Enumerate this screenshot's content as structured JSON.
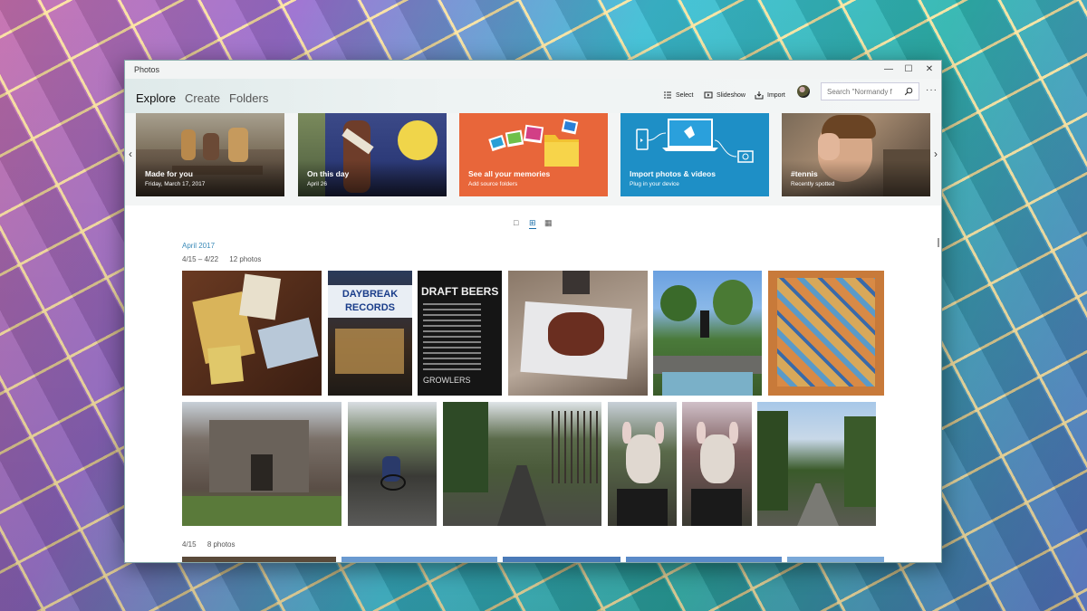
{
  "window": {
    "title": "Photos",
    "controls": {
      "minimize": "—",
      "maximize": "☐",
      "close": "✕"
    }
  },
  "nav": {
    "tabs": [
      {
        "label": "Explore",
        "active": true
      },
      {
        "label": "Create",
        "active": false
      },
      {
        "label": "Folders",
        "active": false
      }
    ],
    "commands": {
      "select": "Select",
      "slideshow": "Slideshow",
      "import": "Import"
    },
    "search_placeholder": "Search \"Normandy f",
    "more": "···"
  },
  "hero_cards": [
    {
      "title": "Made for you",
      "subtitle": "Friday, March 17, 2017"
    },
    {
      "title": "On this day",
      "subtitle": "April 26"
    },
    {
      "title": "See all your memories",
      "subtitle": "Add source folders"
    },
    {
      "title": "Import photos & videos",
      "subtitle": "Plug in your device"
    },
    {
      "title": "#tennis",
      "subtitle": "Recently spotted"
    }
  ],
  "hero_arrows": {
    "prev": "‹",
    "next": "›"
  },
  "view_toggles": [
    {
      "glyph": "□",
      "active": false
    },
    {
      "glyph": "⊞",
      "active": true
    },
    {
      "glyph": "▦",
      "active": false
    }
  ],
  "gallery": {
    "month": "April 2017",
    "groups": [
      {
        "range": "4/15 – 4/22",
        "count": "12 photos"
      },
      {
        "range": "4/15",
        "count": "8 photos"
      }
    ],
    "photo_text": {
      "daybreak": "DAYBREAK RECORDS",
      "beers_title": "DRAFT BEERS",
      "beers_footer": "GROWLERS"
    }
  },
  "colors": {
    "accent": "#3a8ab8",
    "memories_card": "#e8663a",
    "import_card": "#1e8fc6"
  }
}
